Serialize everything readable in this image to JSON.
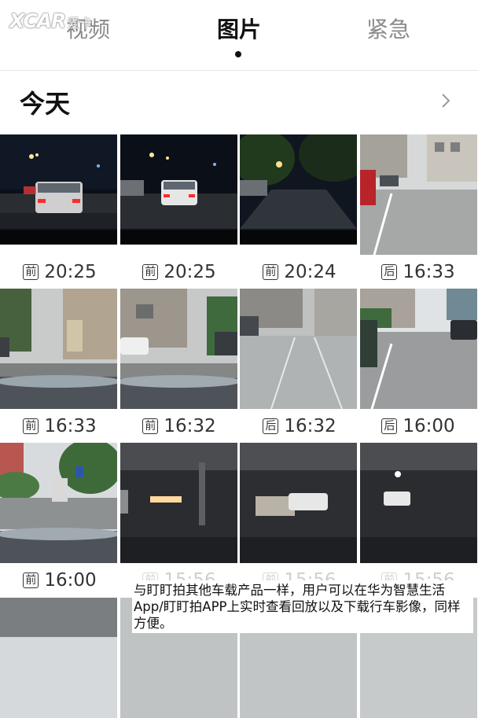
{
  "watermark": {
    "brand": "XCAR",
    "suffix": "爱卡"
  },
  "tabs": [
    {
      "label": "视频",
      "active": false
    },
    {
      "label": "图片",
      "active": true
    },
    {
      "label": "紧急",
      "active": false
    }
  ],
  "section": {
    "title": "今天",
    "chevron_icon": "chevron-right-icon"
  },
  "items": [
    {
      "camera": "前",
      "time": "20:25",
      "scene": "night-street-taillights"
    },
    {
      "camera": "前",
      "time": "20:25",
      "scene": "night-street-taillights"
    },
    {
      "camera": "前",
      "time": "20:24",
      "scene": "night-road-trees"
    },
    {
      "camera": "后",
      "time": "16:33",
      "scene": "day-street-buildings"
    },
    {
      "camera": "前",
      "time": "16:33",
      "scene": "day-alley-buildings"
    },
    {
      "camera": "前",
      "time": "16:32",
      "scene": "day-street-white-car"
    },
    {
      "camera": "后",
      "time": "16:32",
      "scene": "day-road-crossing"
    },
    {
      "camera": "后",
      "time": "16:00",
      "scene": "day-road-bend"
    },
    {
      "camera": "前",
      "time": "16:00",
      "scene": "day-avenue-truck"
    },
    {
      "camera": "前",
      "time": "15:56",
      "scene": "parking-garage-lights"
    },
    {
      "camera": "前",
      "time": "15:56",
      "scene": "parking-garage-car"
    },
    {
      "camera": "前",
      "time": "15:56",
      "scene": "parking-garage-car"
    }
  ],
  "overlay_caption": "与盯盯拍其他车载产品一样，用户可以在华为智慧生活App/盯盯拍APP上实时查看回放以及下载行车影像，同样方便。",
  "colors": {
    "active_tab": "#111111",
    "inactive_tab": "#8a8a8a",
    "divider": "#e6e6e6"
  }
}
